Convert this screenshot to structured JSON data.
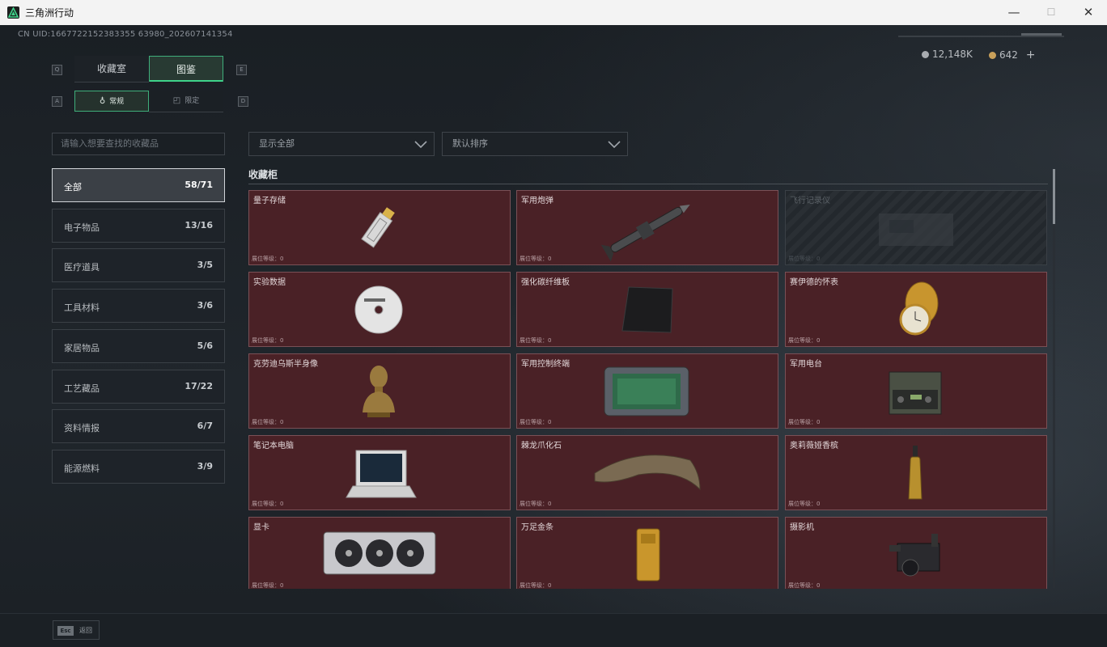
{
  "window": {
    "title": "三角洲行动",
    "min": "—",
    "max": "☐",
    "close": "✕"
  },
  "header": {
    "uid": "CN UID:1667722152383355 63980_202607141354",
    "currency1": "12,148K",
    "currency2": "642",
    "plus": "+"
  },
  "tabs": {
    "left_key": "Q",
    "right_key": "E",
    "items": [
      {
        "label": "收藏室"
      },
      {
        "label": "图鉴"
      }
    ],
    "sub_left_key": "A",
    "sub_right_key": "D",
    "sub": [
      {
        "label": "常规"
      },
      {
        "label": "限定"
      }
    ]
  },
  "search": {
    "placeholder": "请输入想要查找的收藏品"
  },
  "filters": {
    "display": "显示全部",
    "sort": "默认排序"
  },
  "categories": [
    {
      "label": "全部",
      "count": "58/71"
    },
    {
      "label": "电子物品",
      "count": "13/16"
    },
    {
      "label": "医疗道具",
      "count": "3/5"
    },
    {
      "label": "工具材料",
      "count": "3/6"
    },
    {
      "label": "家居物品",
      "count": "5/6"
    },
    {
      "label": "工艺藏品",
      "count": "17/22"
    },
    {
      "label": "资料情报",
      "count": "6/7"
    },
    {
      "label": "能源燃料",
      "count": "3/9"
    }
  ],
  "section": {
    "title": "收藏柜"
  },
  "items": [
    {
      "name": "量子存储",
      "level": "展位等级：0"
    },
    {
      "name": "军用炮弹",
      "level": "展位等级：0"
    },
    {
      "name": "飞行记录仪",
      "level": "展位等级：0"
    },
    {
      "name": "实验数据",
      "level": "展位等级：0"
    },
    {
      "name": "强化碳纤维板",
      "level": "展位等级：0"
    },
    {
      "name": "赛伊德的怀表",
      "level": "展位等级：0"
    },
    {
      "name": "克劳迪乌斯半身像",
      "level": "展位等级：0"
    },
    {
      "name": "军用控制终端",
      "level": "展位等级：0"
    },
    {
      "name": "军用电台",
      "level": "展位等级：0"
    },
    {
      "name": "笔记本电脑",
      "level": "展位等级：0"
    },
    {
      "name": "棘龙爪化石",
      "level": "展位等级：0"
    },
    {
      "name": "奥莉薇娅香槟",
      "level": "展位等级：0"
    },
    {
      "name": "显卡",
      "level": "展位等级：0"
    },
    {
      "name": "万足金条",
      "level": "展位等级：0"
    },
    {
      "name": "摄影机",
      "level": "展位等级：0"
    }
  ],
  "footer": {
    "esc_key": "Esc",
    "esc_label": "返回"
  }
}
